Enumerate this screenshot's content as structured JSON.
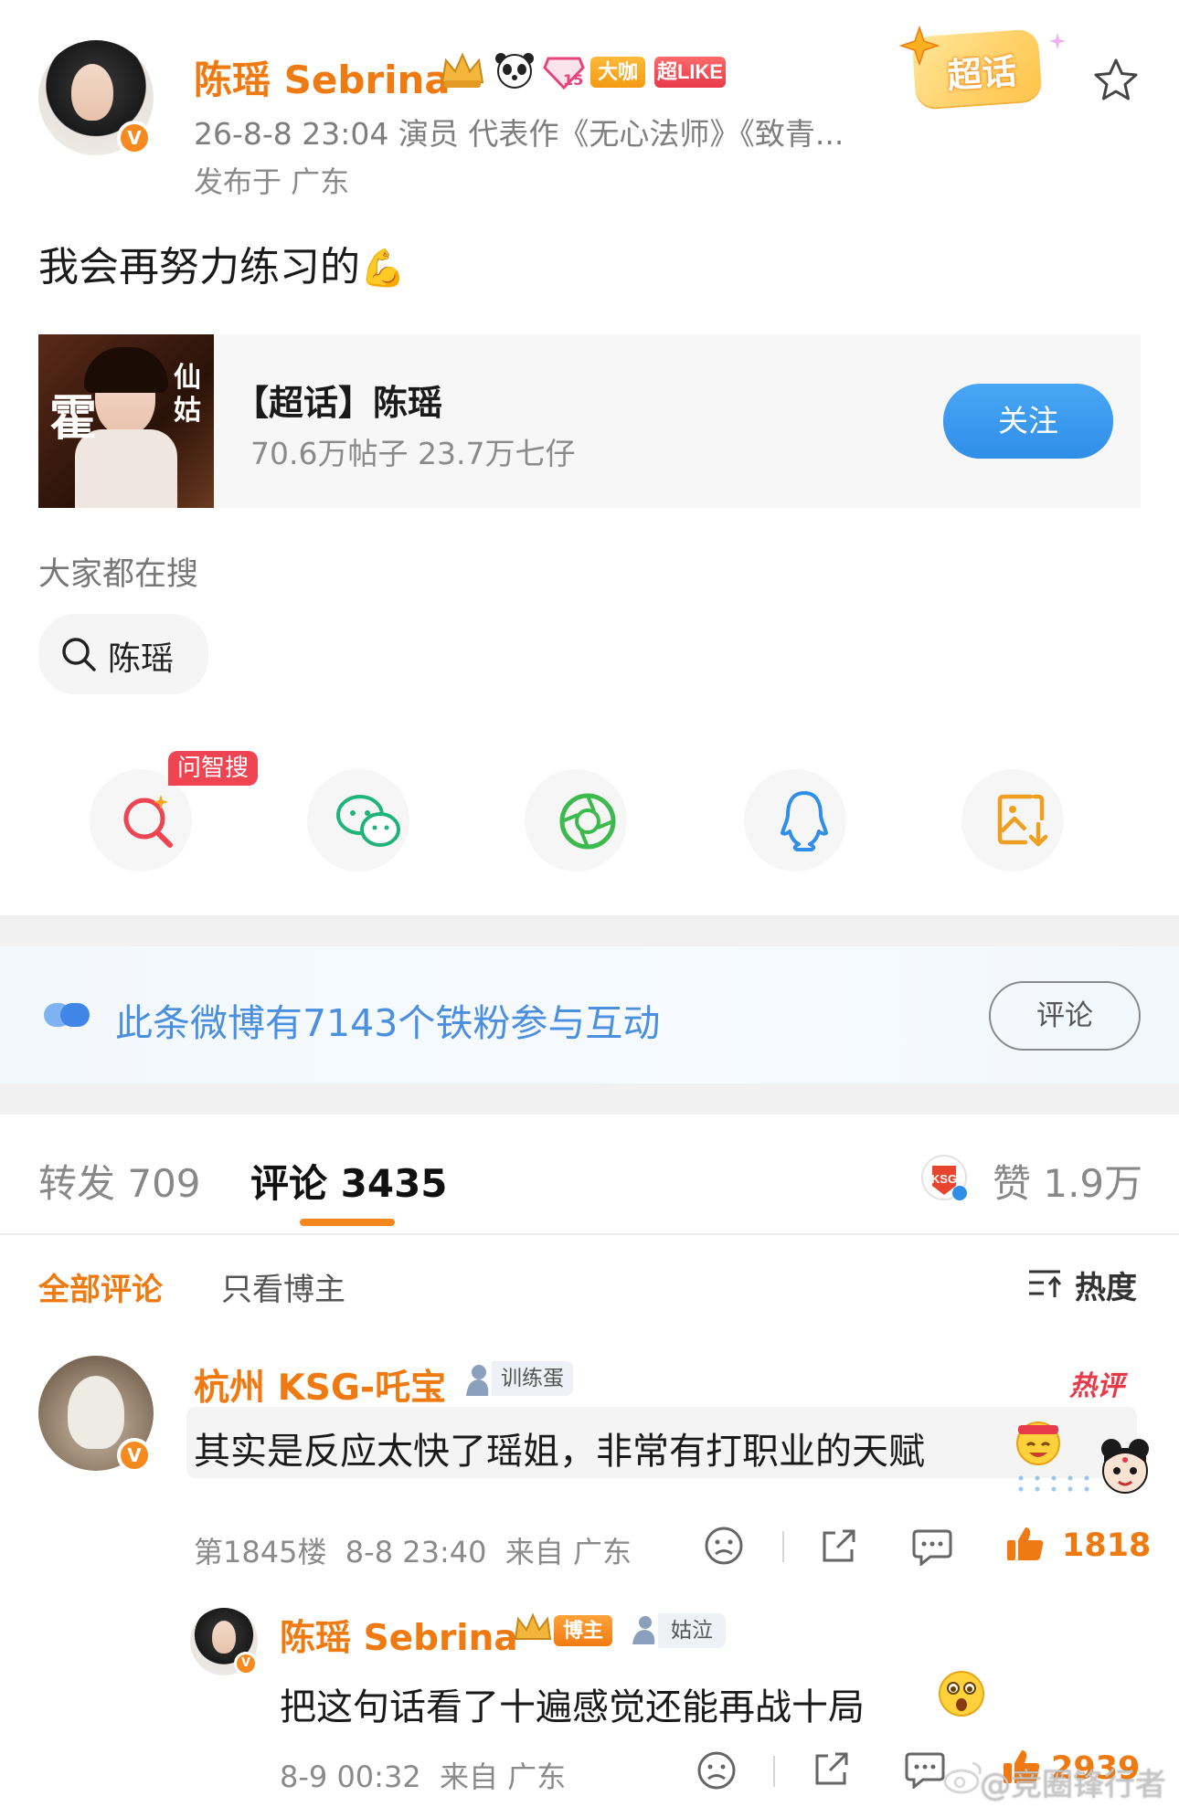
{
  "post": {
    "author": "陈瑶 Sebrina",
    "badges": {
      "daka": "大咖",
      "superlike": "超LIKE",
      "level": "15"
    },
    "meta_line": "26-8-8 23:04  演员 代表作《无心法师》《致青...",
    "published_from": "发布于 广东",
    "super_topic_sticker": "超话",
    "content": "我会再努力练习的",
    "content_emoji": "💪"
  },
  "topic_card": {
    "title": "【超话】陈瑶",
    "stats": "70.6万帖子 23.7万七仔",
    "follow_label": "关注",
    "thumb_text_1": "仙姑",
    "thumb_text_2": "霍"
  },
  "search": {
    "heading": "大家都在搜",
    "query": "陈瑶"
  },
  "share_bar": {
    "ai_tag": "问智搜",
    "items": [
      "search-ai-icon",
      "wechat-icon",
      "moments-icon",
      "qq-icon",
      "save-image-icon"
    ]
  },
  "fans_bar": {
    "text": "此条微博有7143个铁粉参与互动",
    "button": "评论"
  },
  "tabs": {
    "repost": "转发 709",
    "comments": "评论 3435",
    "likes": "赞 1.9万"
  },
  "filters": {
    "all": "全部评论",
    "author_only": "只看博主",
    "sort": "热度"
  },
  "comments": [
    {
      "user": "杭州 KSG-吒宝",
      "tag": "训练蛋",
      "hot": "热评",
      "text": "其实是反应太快了瑶姐，非常有打职业的天赋",
      "meta": "第1845楼  8-8 23:40  来自 广东",
      "likes": "1818"
    },
    {
      "user": "陈瑶 Sebrina",
      "author_tag": "博主",
      "tag": "姑泣",
      "text": "把这句话看了十遍感觉还能再战十局",
      "meta": "8-9 00:32  来自 广东",
      "likes": "2939"
    }
  ],
  "watermark": "@竞圈锋行者",
  "colors": {
    "brand_orange": "#f07a12",
    "follow_blue": "#2f8ee8",
    "fans_blue": "#4a8fe0",
    "like_orange": "#f07a12"
  }
}
